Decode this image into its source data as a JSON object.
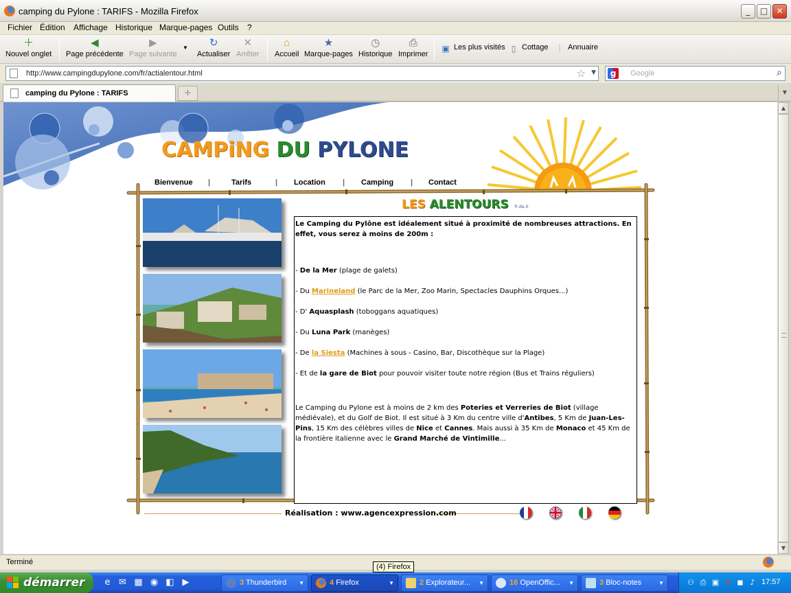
{
  "window": {
    "title": "camping du Pylone : TARIFS - Mozilla Firefox",
    "buttons": [
      "_",
      "□",
      "✕"
    ]
  },
  "menu": [
    "Fichier",
    "Édition",
    "Affichage",
    "Historique",
    "Marque-pages",
    "Outils",
    "?"
  ],
  "toolbar": {
    "new_tab": "Nouvel onglet",
    "back": "Page précédente",
    "forward": "Page suivante",
    "reload": "Actualiser",
    "stop": "Arrêter",
    "home": "Accueil",
    "bookmarks": "Marque-pages",
    "history": "Historique",
    "print": "Imprimer"
  },
  "bookmarks_bar": [
    "Les plus visités",
    "Cottage",
    "Annuaire"
  ],
  "address": {
    "url": "http://www.campingdupylone.com/fr/actialentour.html",
    "search_placeholder": "Google"
  },
  "tabs": [
    {
      "label": "camping du Pylone : TARIFS",
      "active": true
    }
  ],
  "page": {
    "logo": {
      "part1": "CAMPiNG",
      "part2": "DU",
      "part3": "PYLONE"
    },
    "nav": [
      "Bienvenue",
      "Tarifs",
      "Location",
      "Camping",
      "Contact"
    ],
    "nav_separator": "|",
    "section_title": {
      "part1": "LES",
      "part2": "ALENTOURS",
      "tiny": "fr,de,it"
    },
    "intro": "Le Camping du Pylône est idéalement situé à proximité de nombreuses attractions. En effet, vous serez à moins de 200m :",
    "items": [
      {
        "prefix": "- ",
        "bold": "De la Mer",
        "rest": " (plage de galets)"
      },
      {
        "prefix": "- Du ",
        "link": "Marineland",
        "rest": " (le Parc de la Mer, Zoo Marin, Spectacles Dauphins Orques...)"
      },
      {
        "prefix": "- D' ",
        "bold": "Aquasplash",
        "rest": " (toboggans aquatiques)"
      },
      {
        "prefix": "- Du ",
        "bold": "Luna Park",
        "rest": " (manèges)"
      },
      {
        "prefix": "- De ",
        "link": "la Siesta",
        "rest": " (Machines à sous - Casino, Bar, Discothèque sur la Plage)"
      },
      {
        "prefix": "- Et de ",
        "bold": "la gare de Biot",
        "rest": " pour pouvoir visiter toute notre région (Bus et Trains réguliers)"
      }
    ],
    "para": {
      "t1": "Le Camping du Pylone est à moins de 2 km des ",
      "b1": "Poteries et Verreries de Biot",
      "t2": " (village médiévale), et du Golf de Biot. Il est situé à 3 Km du centre ville d'",
      "b2": "Antibes",
      "t3": ", 5 Km de ",
      "b3": "Juan-Les-Pins",
      "t4": ", 15 Km des célèbres villes de ",
      "b4": "Nice",
      "t5": " et ",
      "b5": "Cannes",
      "t6": ". Mais aussi à 35 Km de ",
      "b6": "Monaco",
      "t7": " et 45 Km de la frontière italienne avec le ",
      "b7": "Grand Marché de Vintimille",
      "t8": "..."
    },
    "footer": "Réalisation : www.agencexpression.com",
    "flags": [
      "fr",
      "en",
      "it",
      "de"
    ]
  },
  "status": "Terminé",
  "tooltip": "(4) Firefox",
  "taskbar": {
    "start": "démarrer",
    "tasks": [
      {
        "count": "3",
        "label": "Thunderbird"
      },
      {
        "count": "4",
        "label": "Firefox"
      },
      {
        "count": "2",
        "label": "Explorateur..."
      },
      {
        "count": "16",
        "label": "OpenOffic..."
      },
      {
        "count": "3",
        "label": "Bloc-notes"
      }
    ],
    "clock": "17:57"
  }
}
